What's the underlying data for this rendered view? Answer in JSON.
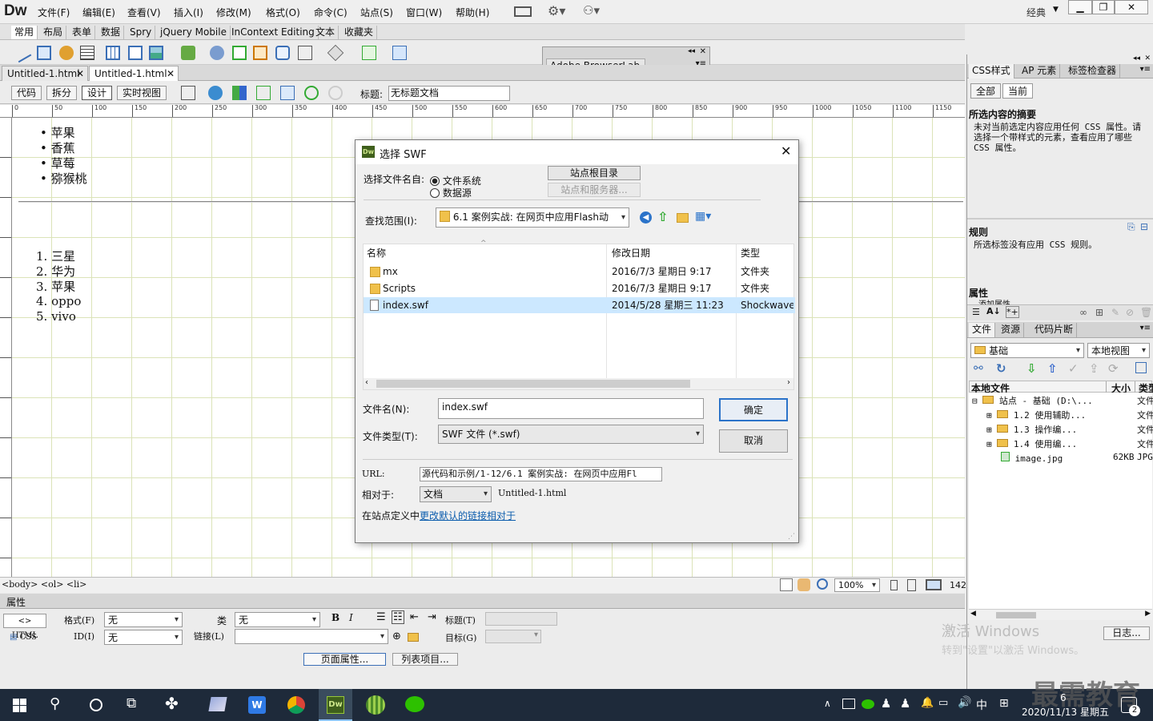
{
  "app": {
    "logo": "Dw",
    "layout_mode": "经典"
  },
  "menu": [
    "文件(F)",
    "编辑(E)",
    "查看(V)",
    "插入(I)",
    "修改(M)",
    "格式(O)",
    "命令(C)",
    "站点(S)",
    "窗口(W)",
    "帮助(H)"
  ],
  "insert_tabs": [
    "常用",
    "布局",
    "表单",
    "数据",
    "Spry",
    "jQuery Mobile",
    "InContext Editing",
    "文本",
    "收藏夹"
  ],
  "doc_tabs": [
    "Untitled-1.html",
    "Untitled-1.html"
  ],
  "view_buttons": [
    "代码",
    "拆分",
    "设计",
    "实时视图"
  ],
  "title_label": "标题:",
  "title_value": "无标题文档",
  "ruler_marks": [
    "0",
    "50",
    "100",
    "150",
    "200",
    "250",
    "300",
    "350",
    "400",
    "450",
    "500",
    "550",
    "600",
    "650",
    "700",
    "750",
    "800",
    "850",
    "900",
    "950",
    "1000",
    "1050",
    "1100",
    "1150"
  ],
  "canvas": {
    "ul_items": [
      "苹果",
      "香蕉",
      "草莓",
      "猕猴桃"
    ],
    "ol_items": [
      "1. 三星",
      "2. 华为",
      "3. 苹果",
      "4. oppo",
      "5. vivo"
    ]
  },
  "status": {
    "tag_path": "<body> <ol> <li>",
    "zoom": "100%",
    "size": "142"
  },
  "properties": {
    "header": "属性",
    "html_btn": "HTML",
    "css_btn": "CSS",
    "format_label": "格式(F)",
    "format_value": "无",
    "class_label": "类",
    "class_value": "无",
    "id_label": "ID(I)",
    "id_value": "无",
    "link_label": "链接(L)",
    "title_label": "标题(T)",
    "target_label": "目标(G)",
    "page_props": "页面属性...",
    "list_item": "列表项目..."
  },
  "browserlab": {
    "title": "Adobe BrowserLab"
  },
  "right_panel": {
    "tabs1": [
      "CSS样式",
      "AP 元素",
      "标签检查器"
    ],
    "mode": [
      "全部",
      "当前"
    ],
    "summary_title": "所选内容的摘要",
    "summary_text": "未对当前选定内容应用任何 CSS 属性。请选择一个带样式的元素，查看应用了哪些 CSS 属性。",
    "rules_title": "规则",
    "rules_text": "所选标签没有应用 CSS 规则。",
    "props_title": "属性",
    "props_add": "添加属性",
    "tabs2": [
      "文件",
      "资源",
      "代码片断"
    ],
    "site_select": "基础",
    "view_select": "本地视图",
    "file_headers": [
      "本地文件",
      "大小",
      "类型"
    ],
    "tree": [
      {
        "name": "站点 - 基础 (D:\\...",
        "size": "",
        "type": "文件"
      },
      {
        "name": "1.2 使用辅助...",
        "size": "",
        "type": "文件"
      },
      {
        "name": "1.3 操作编...",
        "size": "",
        "type": "文件"
      },
      {
        "name": "1.4 使用编...",
        "size": "",
        "type": "文件"
      },
      {
        "name": "image.jpg",
        "size": "62KB",
        "type": "JPG"
      }
    ],
    "log_btn": "日志...",
    "watermark1": "激活 Windows",
    "watermark2": "转到\"设置\"以激活 Windows。"
  },
  "dialog": {
    "title": "选择 SWF",
    "select_name_from": "选择文件名自:",
    "radio_fs": "文件系统",
    "radio_ds": "数据源",
    "site_root": "站点根目录",
    "site_server": "站点和服务器...",
    "look_in_label": "查找范围(I):",
    "look_in_value": "6.1 案例实战: 在网页中应用Flash动",
    "columns": [
      "名称",
      "修改日期",
      "类型"
    ],
    "files": [
      {
        "name": "mx",
        "date": "2016/7/3 星期日 9:17",
        "type": "文件夹",
        "kind": "folder"
      },
      {
        "name": "Scripts",
        "date": "2016/7/3 星期日 9:17",
        "type": "文件夹",
        "kind": "folder"
      },
      {
        "name": "index.swf",
        "date": "2014/5/28 星期三 11:23",
        "type": "Shockwave",
        "kind": "file"
      }
    ],
    "filename_label": "文件名(N):",
    "filename_value": "index.swf",
    "filetype_label": "文件类型(T):",
    "filetype_value": "SWF 文件 (*.swf)",
    "ok": "确定",
    "cancel": "取消",
    "url_label": "URL:",
    "url_value": "源代码和示例/1-12/6.1 案例实战: 在网页中应用Fl",
    "relative_label": "相对于:",
    "relative_value": "文档",
    "relative_doc": "Untitled-1.html",
    "site_def_text": "在站点定义中",
    "site_def_link": "更改默认的链接相对于"
  },
  "taskbar": {
    "time": "6",
    "date": "2020/11/13 星期五",
    "ime": "中",
    "notif": "2",
    "brand": "最需教育"
  },
  "colors": {
    "accent": "#0b5cad",
    "selection": "#cce8ff",
    "taskbar": "#1e2a3a",
    "grid": "#dbe3b8"
  }
}
